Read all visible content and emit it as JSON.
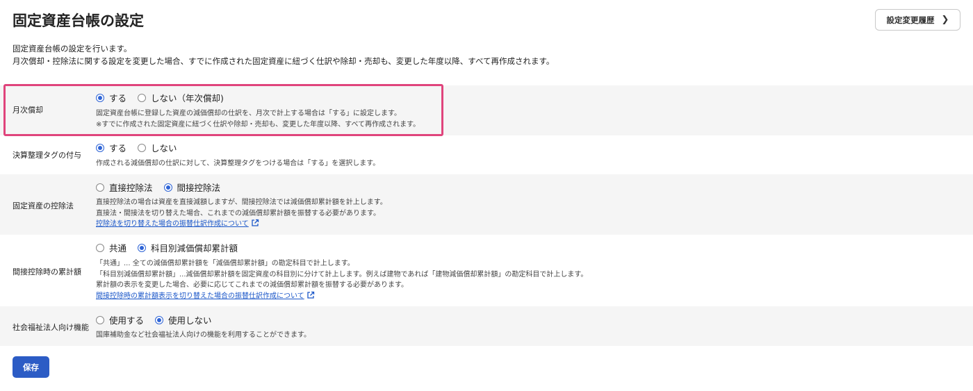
{
  "header": {
    "title": "固定資産台帳の設定",
    "history_button_label": "設定変更履歴"
  },
  "intro": {
    "line1": "固定資産台帳の設定を行います。",
    "line2": "月次償却・控除法に関する設定を変更した場合、すでに作成された固定資産に紐づく仕訳や除却・売却も、変更した年度以降、すべて再作成されます。"
  },
  "settings": [
    {
      "label": "月次償却",
      "options": [
        {
          "label": "する",
          "checked": true
        },
        {
          "label": "しない（年次償却)",
          "checked": false
        }
      ],
      "desc": [
        "固定資産台帳に登録した資産の減価償却の仕訳を、月次で計上する場合は「する」に設定します。",
        "※すでに作成された固定資産に紐づく仕訳や除却・売却も、変更した年度以降、すべて再作成されます。"
      ]
    },
    {
      "label": "決算整理タグの付与",
      "options": [
        {
          "label": "する",
          "checked": true
        },
        {
          "label": "しない",
          "checked": false
        }
      ],
      "desc": [
        "作成される減価償却の仕訳に対して、決算整理タグをつける場合は「する」を選択します。"
      ]
    },
    {
      "label": "固定資産の控除法",
      "options": [
        {
          "label": "直接控除法",
          "checked": false
        },
        {
          "label": "間接控除法",
          "checked": true
        }
      ],
      "desc": [
        "直接控除法の場合は資産を直接減額しますが、間接控除法では減価償却累計額を計上します。",
        "直接法・間接法を切り替えた場合、これまでの減価償却累計額を振替する必要があります。"
      ],
      "link": "控除法を切り替えた場合の振替仕訳作成について"
    },
    {
      "label": "間接控除時の累計額",
      "options": [
        {
          "label": "共通",
          "checked": false
        },
        {
          "label": "科目別減価償却累計額",
          "checked": true
        }
      ],
      "desc": [
        "「共通」... 全ての減価償却累計額を「減価償却累計額」の勘定科目で計上します。",
        "「科目別減価償却累計額」...減価償却累計額を固定資産の科目別に分けて計上します。例えば建物であれば「建物減価償却累計額」の勘定科目で計上します。",
        "累計額の表示を変更した場合、必要に応じてこれまでの減価償却累計額を振替する必要があります。"
      ],
      "link": "間接控除時の累計額表示を切り替えた場合の振替仕訳作成について"
    },
    {
      "label": "社会福祉法人向け機能",
      "options": [
        {
          "label": "使用する",
          "checked": false
        },
        {
          "label": "使用しない",
          "checked": true
        }
      ],
      "desc": [
        "国庫補助金など社会福祉法人向けの機能を利用することができます。"
      ]
    }
  ],
  "save_button_label": "保存",
  "colors": {
    "accent": "#2e64d6",
    "save_button": "#2c5cc5",
    "highlight_border": "#e0447c",
    "link": "#1a56c8"
  },
  "icons": {
    "history_chevron": "chevron-right-icon",
    "external_link": "external-link-icon"
  }
}
